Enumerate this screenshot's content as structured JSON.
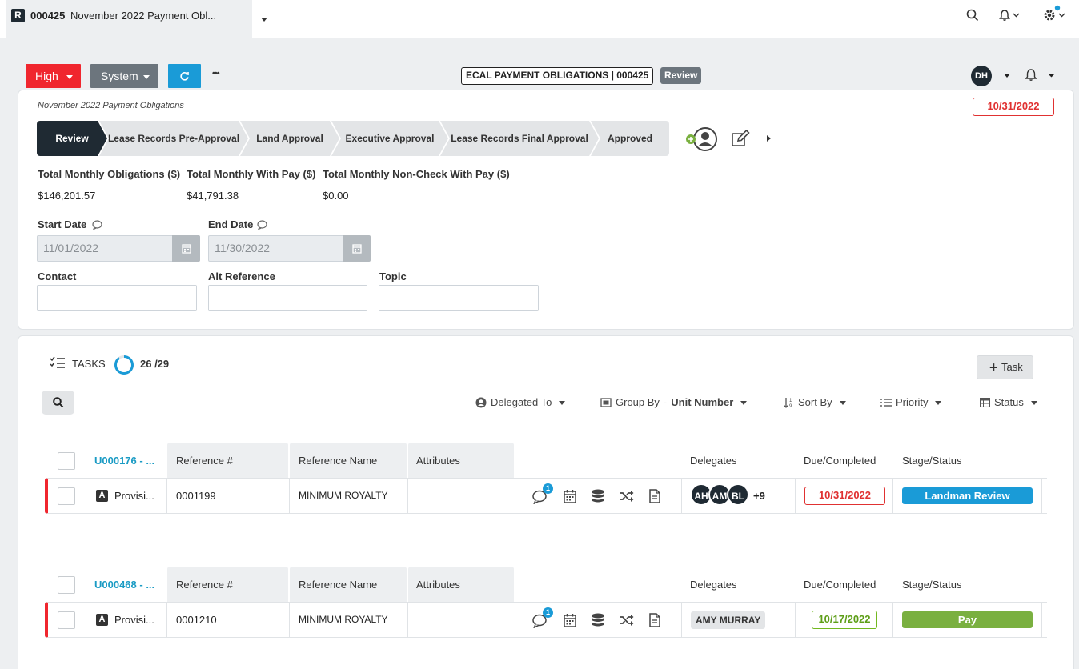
{
  "tab": {
    "id": "000425",
    "title": "November 2022 Payment Obl...",
    "logo_letter": "R"
  },
  "actions": {
    "priority_label": "High",
    "system_label": "System",
    "more": "•••"
  },
  "header": {
    "title": "ECAL PAYMENT OBLIGATIONS | 000425",
    "stage_badge": "Review",
    "user_initials": "DH"
  },
  "record": {
    "subtitle": "November 2022 Payment Obligations",
    "due_date": "10/31/2022",
    "stages": [
      {
        "label": "Review",
        "active": true
      },
      {
        "label": "Lease Records Pre-Approval",
        "active": false
      },
      {
        "label": "Land Approval",
        "active": false
      },
      {
        "label": "Executive Approval",
        "active": false
      },
      {
        "label": "Lease Records Final Approval",
        "active": false
      },
      {
        "label": "Approved",
        "active": false
      }
    ],
    "totals": [
      {
        "label": "Total Monthly Obligations ($)",
        "value": "$146,201.57"
      },
      {
        "label": "Total Monthly With Pay ($)",
        "value": "$41,791.38"
      },
      {
        "label": "Total Monthly Non-Check With Pay ($)",
        "value": "$0.00"
      }
    ],
    "start_date": {
      "label": "Start Date",
      "value": "11/01/2022"
    },
    "end_date": {
      "label": "End Date",
      "value": "11/30/2022"
    },
    "contact": {
      "label": "Contact",
      "value": ""
    },
    "alt_reference": {
      "label": "Alt Reference",
      "value": ""
    },
    "topic": {
      "label": "Topic",
      "value": ""
    }
  },
  "tasks": {
    "label": "TASKS",
    "progress_text": "26 /29",
    "progress_done": 26,
    "progress_total": 29,
    "add_task_label": "Task",
    "toolbar": {
      "delegated_to": "Delegated To",
      "group_by": "Group By",
      "group_by_sep": "-",
      "group_by_value": "Unit Number",
      "sort_by": "Sort By",
      "priority": "Priority",
      "status": "Status"
    },
    "columns": {
      "reference": "Reference #",
      "reference_name": "Reference Name",
      "attributes": "Attributes",
      "delegates": "Delegates",
      "due": "Due/Completed",
      "stage": "Stage/Status"
    },
    "groups": [
      {
        "unit": "U000176 - ...",
        "row": {
          "type_letter": "A",
          "type": "Provisi...",
          "reference": "0001199",
          "reference_name": "MINIMUM ROYALTY",
          "attributes": "",
          "comment_count": "1",
          "delegates": [
            "AH",
            "AM",
            "BL"
          ],
          "delegates_more": "+9",
          "due": "10/31/2022",
          "status": "Landman Review"
        }
      },
      {
        "unit": "U000468 - ...",
        "row": {
          "type_letter": "A",
          "type": "Provisi...",
          "reference": "0001210",
          "reference_name": "MINIMUM ROYALTY",
          "attributes": "",
          "comment_count": "1",
          "delegate_name": "AMY MURRAY",
          "due": "10/17/2022",
          "status": "Pay"
        }
      }
    ]
  },
  "colors": {
    "high": "#f0262e",
    "system": "#6c757d",
    "refresh": "#1a9bd7",
    "dark": "#1f2a33",
    "accent": "#1a9bc4"
  }
}
